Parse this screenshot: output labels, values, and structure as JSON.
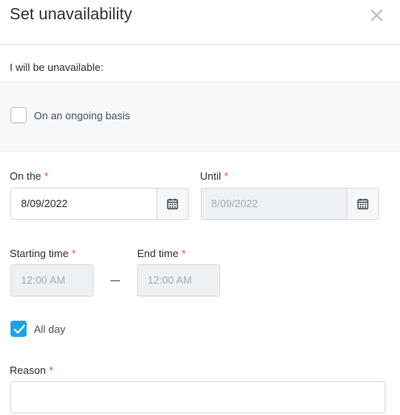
{
  "dialog": {
    "title": "Set unavailability"
  },
  "availability": {
    "section_label": "I will be unavailable:",
    "ongoing_label": "On an ongoing basis",
    "ongoing_checked": false
  },
  "dates": {
    "on_the_label": "On the",
    "on_the_value": "8/09/2022",
    "until_label": "Until",
    "until_value": "8/09/2022",
    "required_mark": "*"
  },
  "times": {
    "starting_label": "Starting time",
    "starting_value": "12:00 AM",
    "end_label": "End time",
    "end_value": "12:00 AM"
  },
  "all_day": {
    "label": "All day",
    "checked": true
  },
  "reason": {
    "label": "Reason",
    "value": ""
  },
  "colors": {
    "accent": "#1aa3e8",
    "required": "#e8474c"
  }
}
